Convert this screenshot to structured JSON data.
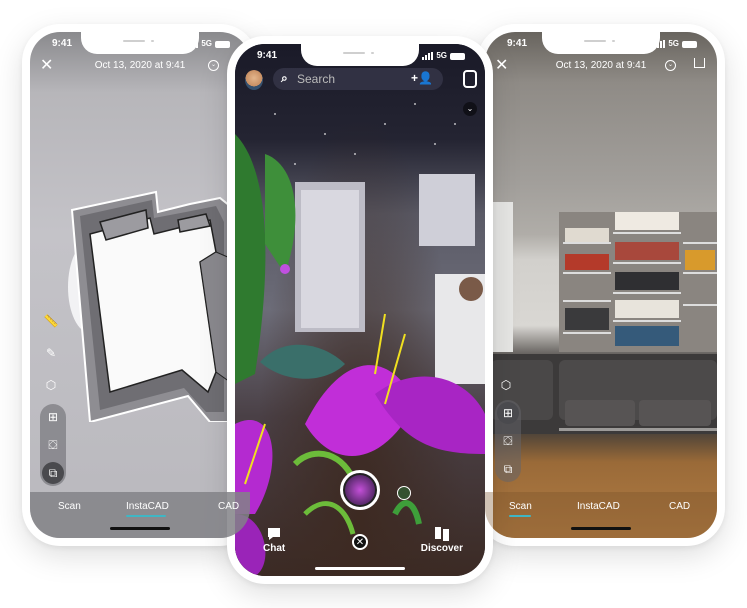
{
  "status_bar": {
    "time": "9:41",
    "network": "5G"
  },
  "left_phone": {
    "header": {
      "close_icon": "close-icon",
      "date": "Oct 13, 2020 at 9:41",
      "menu_icon": "chevron-circle-icon"
    },
    "tools": [
      "ruler-icon",
      "edit-measure-icon",
      "ar-cube-icon"
    ],
    "view_modes": [
      "elevation-icon",
      "3d-model-icon",
      "floorplan-icon"
    ],
    "active_view_mode": "floorplan-icon",
    "tabs": [
      "Scan",
      "InstaCAD",
      "CAD"
    ],
    "active_tab": "InstaCAD"
  },
  "center_phone": {
    "search": {
      "placeholder": "Search"
    },
    "icons": [
      "avatar",
      "add-friend-icon",
      "flip-camera-icon",
      "chevron-down-icon"
    ],
    "bottom_nav": {
      "chat": "Chat",
      "discover": "Discover"
    },
    "capture_icon": "capture-lens-icon",
    "close_icon": "close-icon"
  },
  "right_phone": {
    "header": {
      "close_icon": "close-icon",
      "date": "Oct 13, 2020 at 9:41",
      "menu_icon": "chevron-circle-icon",
      "share_icon": "share-icon"
    },
    "tools": [
      "ar-cube-icon"
    ],
    "view_modes": [
      "elevation-icon",
      "3d-model-icon",
      "floorplan-icon"
    ],
    "active_view_mode": "elevation-icon",
    "tabs": [
      "Scan",
      "InstaCAD",
      "CAD"
    ],
    "active_tab": "Scan"
  }
}
